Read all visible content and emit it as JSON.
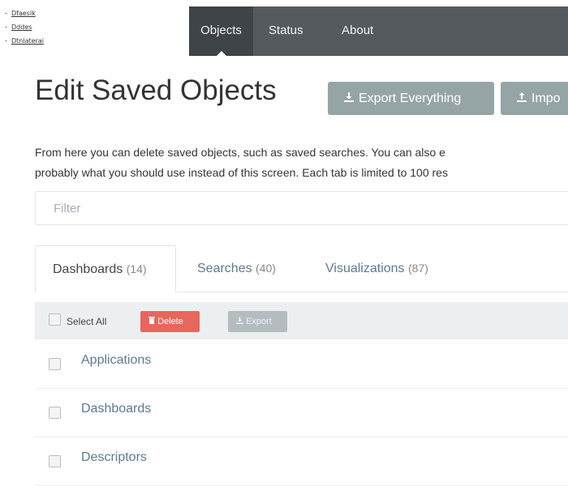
{
  "side_links": [
    "Dfaeslk",
    "Dddes",
    "Dtnlaterai"
  ],
  "nav": {
    "tabs": [
      {
        "label": "Objects",
        "active": true
      },
      {
        "label": "Status",
        "active": false
      },
      {
        "label": "About",
        "active": false
      }
    ]
  },
  "page": {
    "title": "Edit Saved Objects",
    "export_button": "Export Everything",
    "import_button": "Impo",
    "description_line1": "From here you can delete saved objects, such as saved searches. You can also e",
    "description_line2": "probably what you should use instead of this screen. Each tab is limited to 100 res"
  },
  "filter": {
    "placeholder": "Filter",
    "value": ""
  },
  "tabs": [
    {
      "label": "Dashboards",
      "count": "(14)",
      "active": true
    },
    {
      "label": "Searches",
      "count": "(40)",
      "active": false
    },
    {
      "label": "Visualizations",
      "count": "(87)",
      "active": false
    }
  ],
  "toolbar": {
    "select_all": "Select All",
    "delete": "Delete",
    "export": "Export"
  },
  "rows": [
    {
      "name": "Applications"
    },
    {
      "name": "Dashboards"
    },
    {
      "name": "Descriptors"
    }
  ],
  "colors": {
    "navbar": "#555a5f",
    "navbar_active": "#3f4449",
    "button": "#95a5a6",
    "delete": "#e7665d",
    "link": "#5b7a94"
  }
}
